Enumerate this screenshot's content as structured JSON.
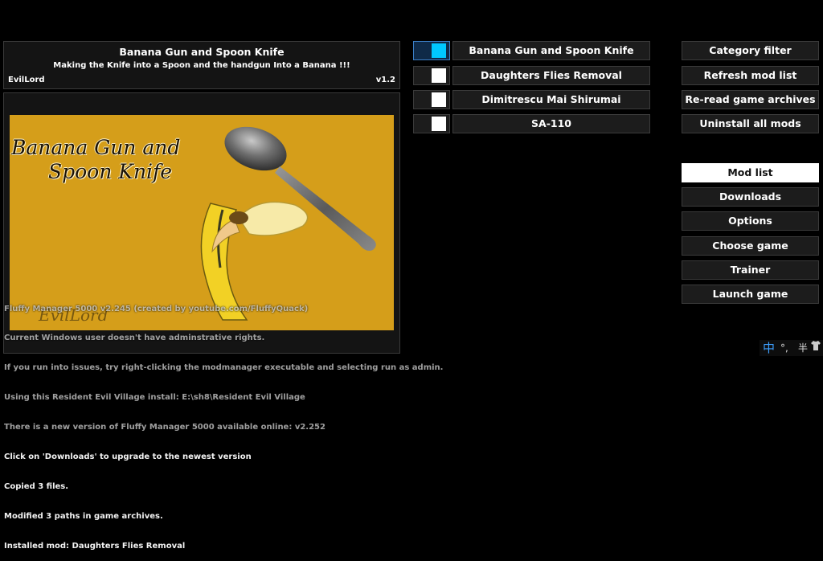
{
  "mod_info": {
    "title": "Banana Gun and Spoon Knife",
    "description": "Making the Knife into a Spoon and the handgun Into a Banana !!!",
    "author": "EvilLord",
    "version": "v1.2"
  },
  "preview": {
    "title_line1": "Banana Gun and",
    "title_line2": "Spoon Knife",
    "overlay_text": "EvilLord"
  },
  "mods": [
    {
      "label": "Banana Gun and Spoon Knife",
      "enabled": true
    },
    {
      "label": "Daughters Flies Removal",
      "enabled": false
    },
    {
      "label": "Dimitrescu Mai Shirumai",
      "enabled": false
    },
    {
      "label": "SA-110",
      "enabled": false
    }
  ],
  "actions": {
    "category_filter": "Category filter",
    "refresh": "Refresh mod list",
    "reread": "Re-read game archives",
    "uninstall": "Uninstall all mods"
  },
  "nav": {
    "mod_list": "Mod list",
    "downloads": "Downloads",
    "options": "Options",
    "choose_game": "Choose game",
    "trainer": "Trainer",
    "launch": "Launch game"
  },
  "log": [
    "Fluffy Manager 5000 v2.245 (created by youtube.com/FluffyQuack)",
    "Current Windows user doesn't have adminstrative rights.",
    "If you run into issues, try right-clicking the modmanager executable and selecting run as admin.",
    "Using this Resident Evil Village install: E:\\sh8\\Resident Evil Village",
    "There is a new version of Fluffy Manager 5000 available online: v2.252",
    "Click on 'Downloads' to upgrade to the newest version",
    "Copied 3 files.",
    "Modified 3 paths in game archives.",
    "Installed mod: Daughters Flies Removal"
  ],
  "ime": {
    "chinese": "中",
    "symbols": "°,",
    "half": "半"
  },
  "colors": {
    "background": "#000000",
    "panel": "#1c1c1c",
    "toggle_on": "#00c8ff",
    "preview_bg": "#d59e1a"
  }
}
